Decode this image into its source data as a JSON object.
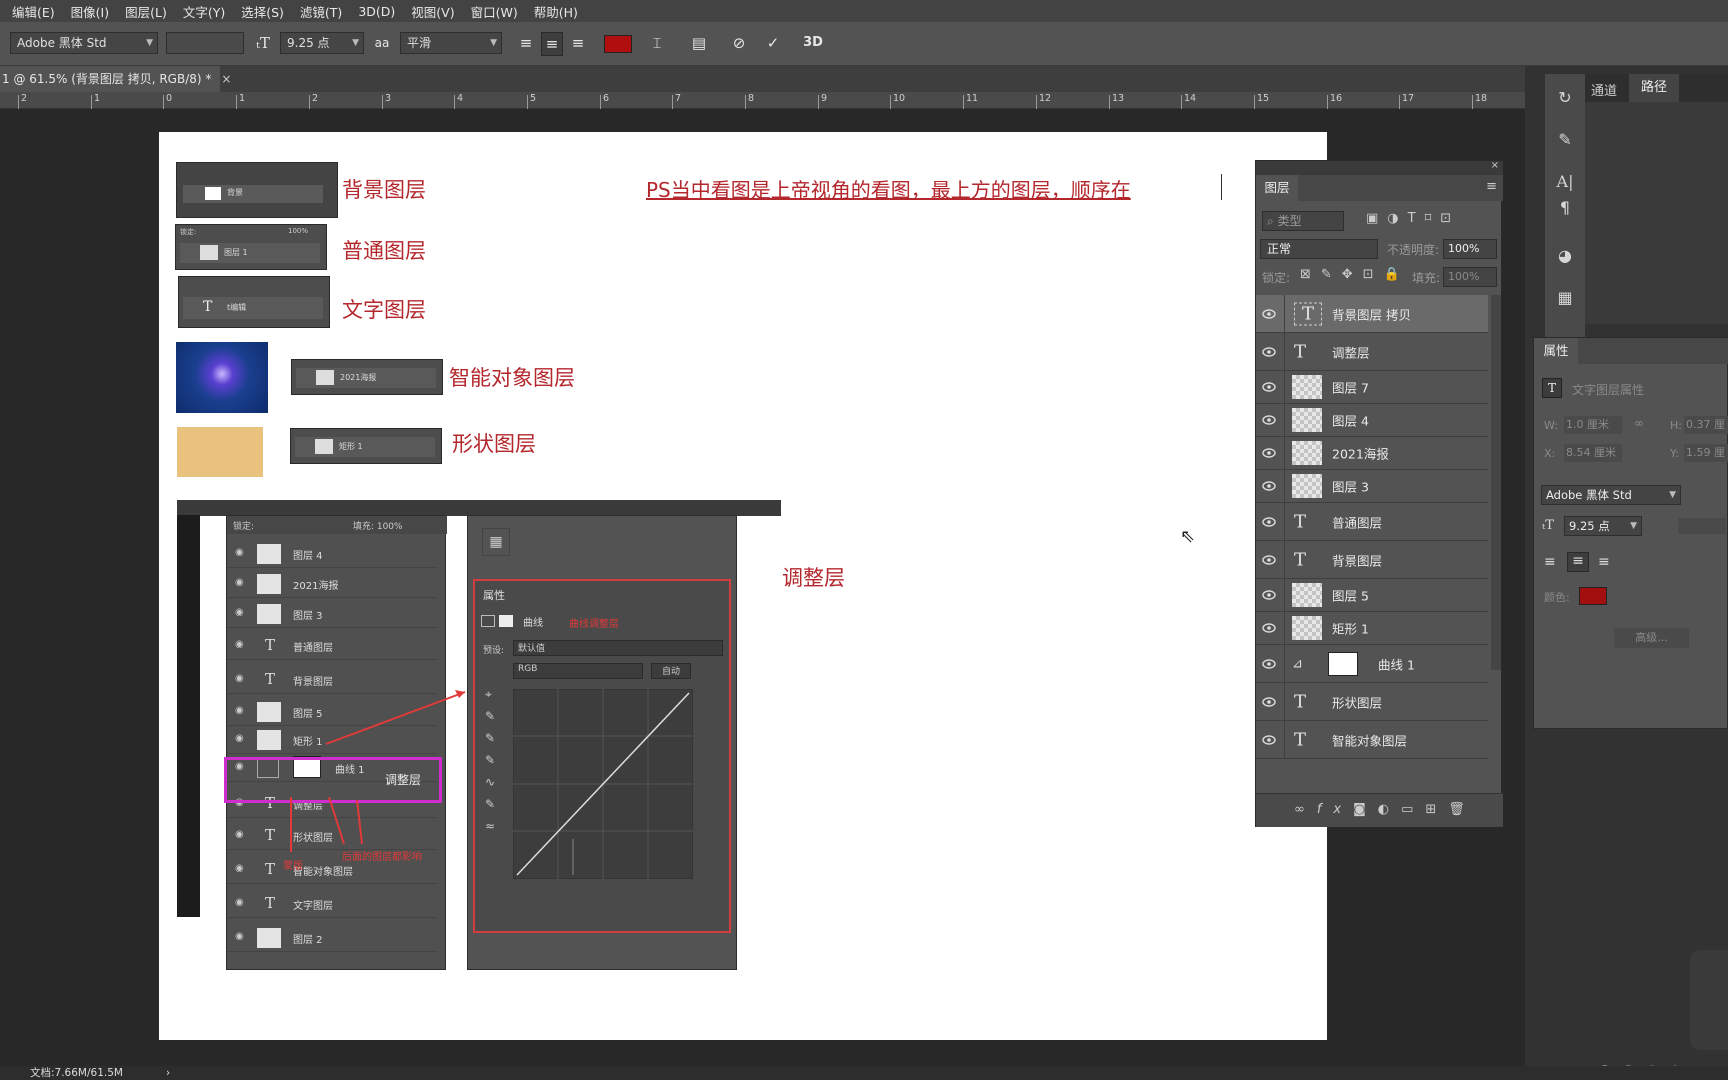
{
  "menu": [
    "编辑(E)",
    "图像(I)",
    "图层(L)",
    "文字(Y)",
    "选择(S)",
    "滤镜(T)",
    "3D(D)",
    "视图(V)",
    "窗口(W)",
    "帮助(H)"
  ],
  "options": {
    "font_family": "Adobe 黑体 Std",
    "font_size": "9.25 点",
    "aa_icon": "aa",
    "aa_mode": "平滑",
    "text_color": "#b10f0f",
    "three_d": "3D"
  },
  "tab": {
    "title": "1 @ 61.5% (背景图层 拷贝, RGB/8) *",
    "close": "×"
  },
  "ruler": [
    "2",
    "1",
    "0",
    "1",
    "2",
    "3",
    "4",
    "5",
    "6",
    "7",
    "8",
    "9",
    "10",
    "11",
    "12",
    "13",
    "14",
    "15",
    "16",
    "17",
    "18"
  ],
  "canvas": {
    "heading": "PS当中看图是上帝视角的看图，最上方的图层，顺序在",
    "labels": {
      "background": "背景图层",
      "normal": "普通图层",
      "text": "文字图层",
      "smart": "智能对象图层",
      "shape": "形状图层",
      "adjust": "调整层"
    },
    "mini": {
      "bg_name": "背景",
      "normal_name": "图层 1",
      "text_name": "t编辑",
      "smart_name": "2021海报",
      "shape_name": "矩形 1",
      "lock": "锁定:",
      "fill": "填充:",
      "fill_val": "100%"
    },
    "shot": {
      "layers": [
        "图层 4",
        "2021海报",
        "图层 3",
        "普通图层",
        "背景图层",
        "图层 5",
        "矩形 1",
        "曲线 1",
        "调整层",
        "形状图层",
        "智能对象图层",
        "文字图层",
        "图层 2"
      ],
      "adjust_tag": "调整层",
      "mask_note": "蒙版",
      "adj_note": "后面的图层都影响",
      "props_title": "属性",
      "curves": "曲线",
      "curves_note": "曲线调整层",
      "preset_label": "预设:",
      "preset_val": "默认值",
      "channel": "RGB",
      "auto": "自动"
    }
  },
  "channels": {
    "tab1": "通道",
    "tab2": "路径"
  },
  "layers": {
    "title": "图层",
    "filter": "类型",
    "blend": "正常",
    "opacity_label": "不透明度:",
    "opacity": "100%",
    "lock_label": "锁定:",
    "fill_label": "填充:",
    "fill": "100%",
    "rows": [
      {
        "name": "背景图层 拷贝",
        "kind": "text"
      },
      {
        "name": "调整层",
        "kind": "text"
      },
      {
        "name": "图层 7",
        "kind": "pixel"
      },
      {
        "name": "图层 4",
        "kind": "pixel"
      },
      {
        "name": "2021海报",
        "kind": "smart"
      },
      {
        "name": "图层 3",
        "kind": "pixel"
      },
      {
        "name": "普通图层",
        "kind": "text"
      },
      {
        "name": "背景图层",
        "kind": "text"
      },
      {
        "name": "图层 5",
        "kind": "pixel"
      },
      {
        "name": "矩形 1",
        "kind": "shape"
      },
      {
        "name": "曲线 1",
        "kind": "adjust"
      },
      {
        "name": "形状图层",
        "kind": "text"
      },
      {
        "name": "智能对象图层",
        "kind": "text"
      }
    ],
    "footer_fx": "fx"
  },
  "props": {
    "title": "属性",
    "subtitle": "文字图层属性",
    "w_label": "W:",
    "w": "1.0 厘米",
    "h_label": "H:",
    "h": "0.37 厘",
    "x_label": "X:",
    "x": "8.54 厘米",
    "y_label": "Y:",
    "y": "1.59 厘",
    "font": "Adobe 黑体 Std",
    "size": "9.25 点",
    "color_label": "颜色:",
    "color": "#a30f0f",
    "advanced": "高级..."
  },
  "status": {
    "doc": "文档:7.66M/61.5M",
    "arrow": "›"
  }
}
